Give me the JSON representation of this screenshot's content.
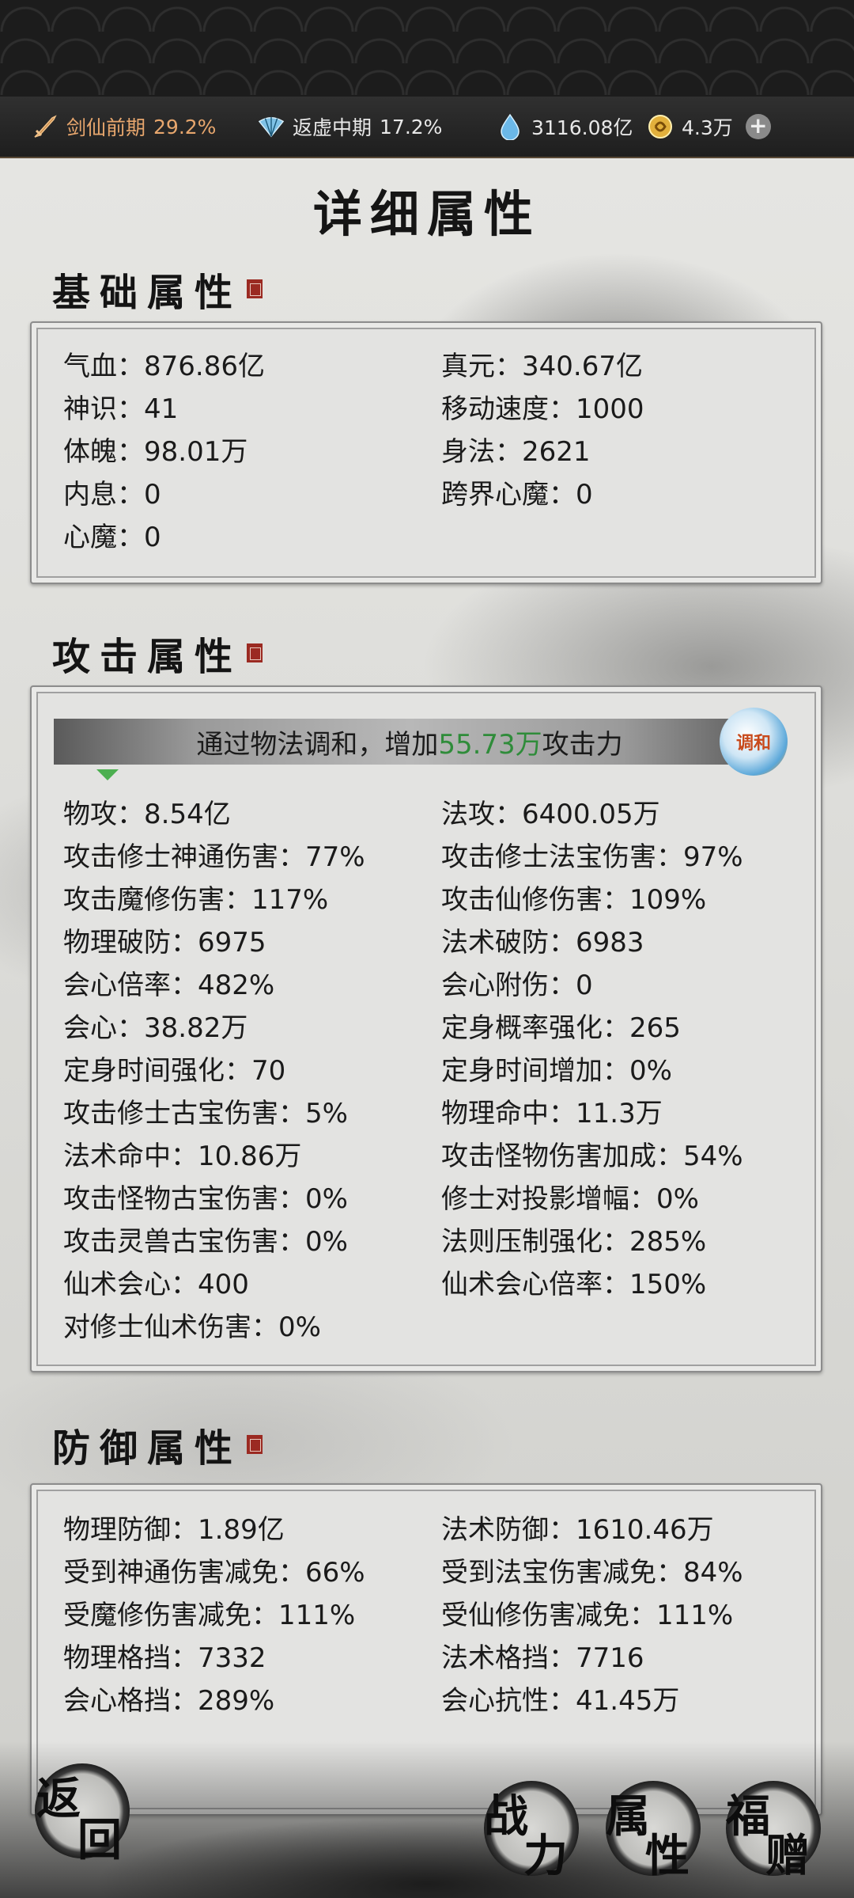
{
  "topbar": {
    "realm1_label": "剑仙前期",
    "realm1_pct": "29.2%",
    "realm2_label": "返虚中期",
    "realm2_pct": "17.2%",
    "stone": "3116.08亿",
    "coin": "4.3万",
    "plus": "+"
  },
  "page_title": "详细属性",
  "sections": {
    "basic": {
      "title": "基础属性",
      "items": [
        "气血：876.86亿",
        "真元：340.67亿",
        "神识：41",
        "移动速度：1000",
        "体魄：98.01万",
        "身法：2621",
        "内息：0",
        "跨界心魔：0",
        "心魔：0"
      ]
    },
    "attack": {
      "title": "攻击属性",
      "banner_pre": "通过物法调和，增加",
      "banner_value": "55.73万",
      "banner_post": "攻击力",
      "badge": "调和",
      "items": [
        "物攻：8.54亿",
        "法攻：6400.05万",
        "攻击修士神通伤害：77%",
        "攻击修士法宝伤害：97%",
        "攻击魔修伤害：117%",
        "攻击仙修伤害：109%",
        "物理破防：6975",
        "法术破防：6983",
        "会心倍率：482%",
        "会心附伤：0",
        "会心：38.82万",
        "定身概率强化：265",
        "定身时间强化：70",
        "定身时间增加：0%",
        "攻击修士古宝伤害：5%",
        "物理命中：11.3万",
        "法术命中：10.86万",
        "攻击怪物伤害加成：54%",
        "攻击怪物古宝伤害：0%",
        "修士对投影增幅：0%",
        "攻击灵兽古宝伤害：0%",
        "法则压制强化：285%",
        "仙术会心：400",
        "仙术会心倍率：150%",
        "对修士仙术伤害：0%"
      ]
    },
    "defense": {
      "title": "防御属性",
      "items": [
        "物理防御：1.89亿",
        "法术防御：1610.46万",
        "受到神通伤害减免：66%",
        "受到法宝伤害减免：84%",
        "受魔修伤害减免：111%",
        "受仙修伤害减免：111%",
        "物理格挡：7332",
        "法术格挡：7716",
        "会心格挡：289%",
        "会心抗性：41.45万"
      ]
    }
  },
  "buttons": {
    "back": [
      "返",
      "回"
    ],
    "power": [
      "战",
      "力"
    ],
    "attrs": [
      "属",
      "性"
    ],
    "gift": [
      "福",
      "赠"
    ]
  }
}
